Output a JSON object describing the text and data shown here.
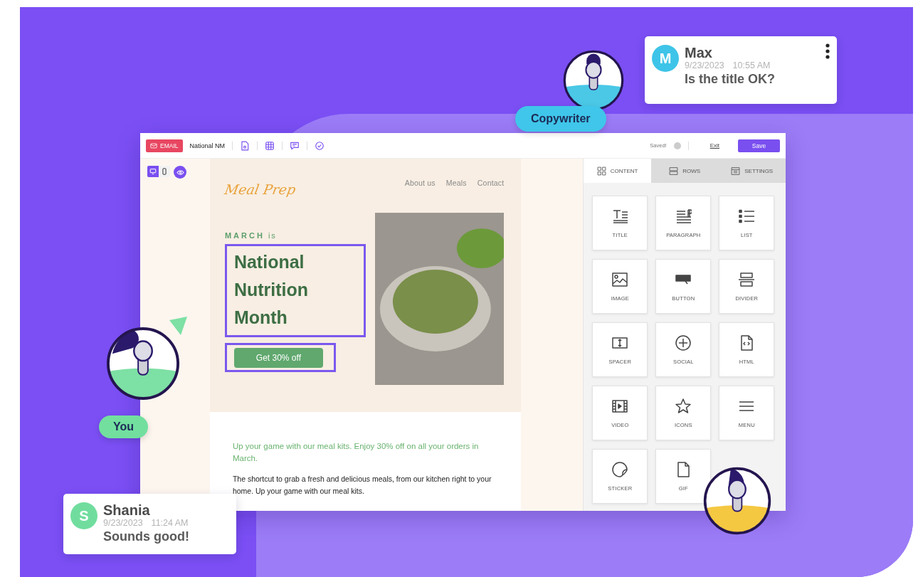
{
  "editor": {
    "toolbar": {
      "badge": "EMAIL",
      "document_name": "National NM",
      "status": "Saved!",
      "exit": "Exit",
      "save": "Save"
    },
    "view_modes": [
      {
        "kind": "desktop",
        "selected": true
      },
      {
        "kind": "mobile",
        "selected": false
      }
    ],
    "email": {
      "logo": "Meal Prep",
      "nav": [
        "About us",
        "Meals",
        "Contact"
      ],
      "eyebrow": "**MARCH** is",
      "headline": "National Nutrition Month",
      "cta": "Get 30% off",
      "intro": "Up your game with our meal kits. Enjoy 30% off on all your orders in March.",
      "body": "The shortcut to grab a fresh and delicious meals, from our kitchen right to your home. Up your game with our meal kits."
    },
    "panel": {
      "tabs": [
        {
          "label": "CONTENT",
          "kind": "content",
          "selected": true
        },
        {
          "label": "ROWS",
          "kind": "rows",
          "selected": false
        },
        {
          "label": "SETTINGS",
          "kind": "settings",
          "selected": false
        }
      ],
      "blocks": [
        {
          "label": "TITLE",
          "kind": "title"
        },
        {
          "label": "PARAGRAPH",
          "kind": "paragraph"
        },
        {
          "label": "LIST",
          "kind": "list"
        },
        {
          "label": "IMAGE",
          "kind": "image"
        },
        {
          "label": "BUTTON",
          "kind": "button"
        },
        {
          "label": "DIVIDER",
          "kind": "divider"
        },
        {
          "label": "SPACER",
          "kind": "spacer"
        },
        {
          "label": "SOCIAL",
          "kind": "social"
        },
        {
          "label": "HTML",
          "kind": "html"
        },
        {
          "label": "VIDEO",
          "kind": "video"
        },
        {
          "label": "ICONS",
          "kind": "icons"
        },
        {
          "label": "MENU",
          "kind": "menu"
        },
        {
          "label": "STICKER",
          "kind": "sticker"
        },
        {
          "label": "GIF",
          "kind": "gif"
        }
      ]
    }
  },
  "collaborators": [
    {
      "role": "Copywriter",
      "kind": "copywriter"
    },
    {
      "role": "You",
      "kind": "you"
    }
  ],
  "comments": [
    {
      "initial": "M",
      "author": "Max",
      "date": "9/23/2023",
      "time": "10:55 AM",
      "message": "Is the title OK?",
      "color": "#3ec4e8"
    },
    {
      "initial": "S",
      "author": "Shania",
      "date": "9/23/2023",
      "time": "11:24 AM",
      "message": "Sounds good!",
      "color": "#70dd9e"
    }
  ]
}
